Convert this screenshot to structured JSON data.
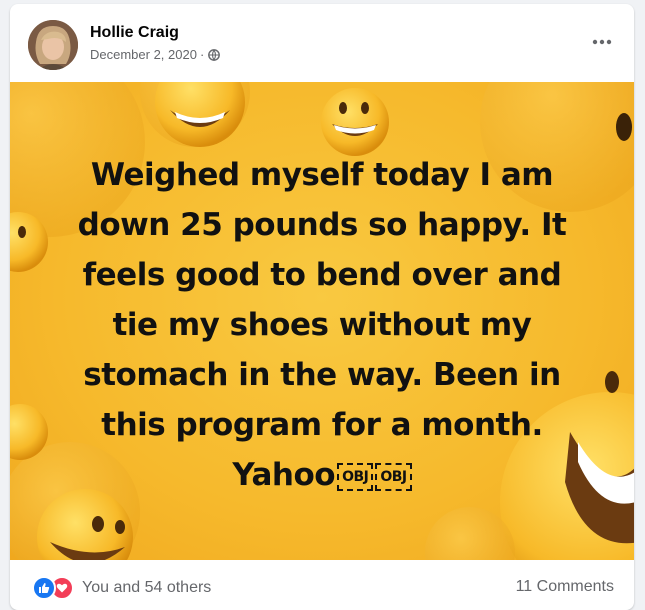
{
  "post": {
    "author": "Hollie Craig",
    "date": "December 2, 2020",
    "separator": "·",
    "privacy_icon": "globe-icon",
    "more_icon": "more-options-icon",
    "text_lines": [
      "Weighed myself today I am",
      "down 25 pounds so happy. It",
      "feels good to bend over and",
      "tie my shoes without my",
      "stomach in the way. Been in",
      "this program for a month.",
      "Yahoo"
    ],
    "obj_placeholders": [
      "OBJ",
      "OBJ"
    ],
    "image_bg_color": "#f6b92c"
  },
  "footer": {
    "reaction_icons": [
      "like-icon",
      "love-icon"
    ],
    "reactions_text": "You and 54 others",
    "comments_text": "11 Comments"
  },
  "colors": {
    "accent_like": "#1877f2",
    "accent_love": "#f33e58",
    "secondary_text": "#65676b"
  }
}
